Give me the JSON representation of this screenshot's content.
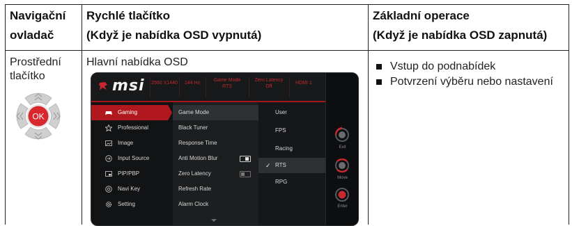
{
  "table": {
    "headers": {
      "col1": [
        "Navigační",
        "ovladač"
      ],
      "col2": [
        "Rychlé tlačítko",
        "(Když je nabídka OSD vypnutá)"
      ],
      "col3": [
        "Základní operace",
        "(Když je nabídka OSD zapnutá)"
      ]
    },
    "row1": {
      "col1": [
        "Prostřední",
        "tlačítko"
      ],
      "col2": "Hlavní nabídka OSD",
      "col3_bullets": [
        "Vstup do podnabídek",
        "Potvrzení výběru nebo nastavení"
      ]
    }
  },
  "joystick": {
    "center_label": "OK",
    "accent_color": "#d9272e"
  },
  "osd": {
    "logo": "msi",
    "status_bar": [
      {
        "line1": "2560 X1440",
        "line2": ""
      },
      {
        "line1": "144 Hz",
        "line2": ""
      },
      {
        "line1": "Game Mode",
        "line2": "RTS"
      },
      {
        "line1": "Zero Latency",
        "line2": "Off"
      },
      {
        "line1": "HDMI 1",
        "line2": ""
      }
    ],
    "main_menu": [
      {
        "label": "Gaming",
        "icon": "gamepad-icon"
      },
      {
        "label": "Professional",
        "icon": "star-icon"
      },
      {
        "label": "Image",
        "icon": "image-icon"
      },
      {
        "label": "Input Source",
        "icon": "input-source-icon"
      },
      {
        "label": "PIP/PBP",
        "icon": "pip-icon"
      },
      {
        "label": "Navi Key",
        "icon": "navi-key-icon"
      },
      {
        "label": "Setting",
        "icon": "gear-icon"
      }
    ],
    "sub_menu": [
      "Game Mode",
      "Black Tuner",
      "Response Time",
      "Anti Motion Blur",
      "Zero Latency",
      "Refresh Rate",
      "Alarm Clock"
    ],
    "options": [
      "User",
      "FPS",
      "Racing",
      "RTS",
      "RPG"
    ],
    "side_buttons": [
      "Exit",
      "Move",
      "Enter"
    ],
    "accent_color": "#b1181e"
  }
}
